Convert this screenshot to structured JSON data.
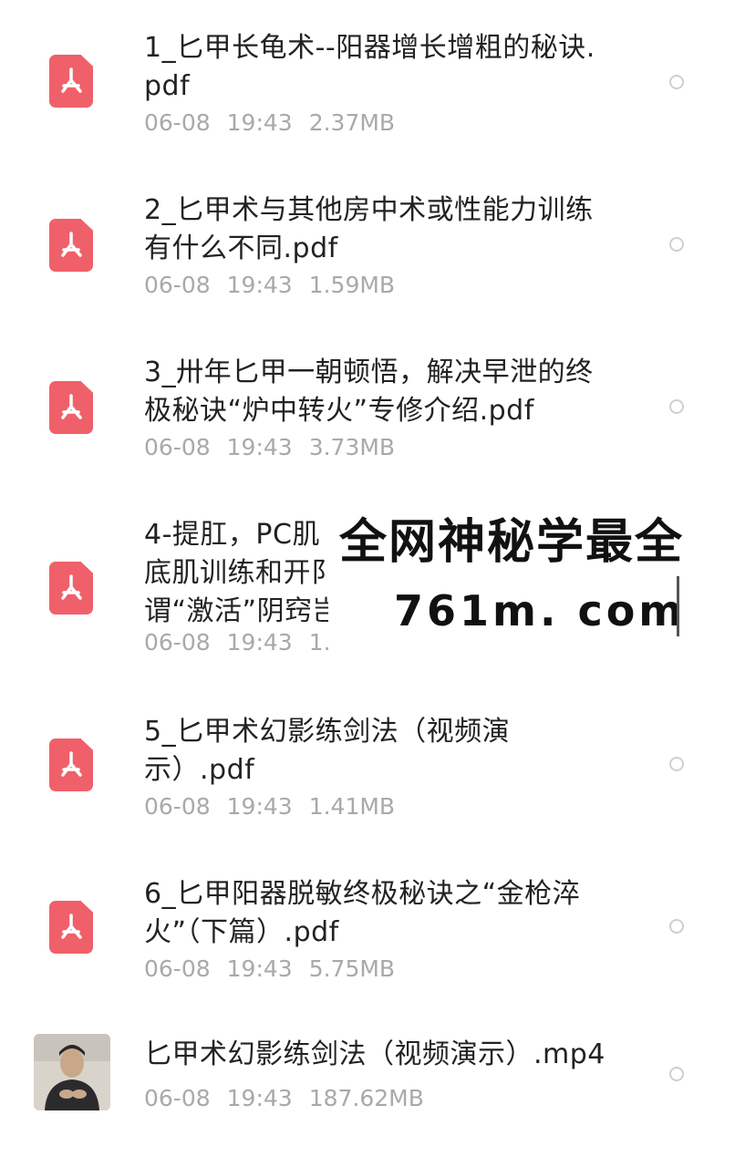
{
  "files": [
    {
      "name": "1_匕甲长龟术--阳器增长增粗的秘诀.pdf",
      "date": "06-08",
      "time": "19:43",
      "size": "2.37MB",
      "type": "pdf-icon"
    },
    {
      "name": "2_匕甲术与其他房中术或性能力训练有什么不同.pdf",
      "date": "06-08",
      "time": "19:43",
      "size": "1.59MB",
      "type": "pdf-icon"
    },
    {
      "name": "3_卅年匕甲一朝顿悟，解决早泄的终极秘诀“炉中转火”专修介绍.pdf",
      "date": "06-08",
      "time": "19:43",
      "size": "3.73MB",
      "type": "pdf-icon"
    },
    {
      "name": "4-提肛，PC肌底肌训练和开阝谓“激活”阴窍岂",
      "date": "06-08",
      "time": "19:43",
      "size": "1.",
      "type": "pdf-icon"
    },
    {
      "name": "5_匕甲术幻影练剑法（视频演示）.pdf",
      "date": "06-08",
      "time": "19:43",
      "size": "1.41MB",
      "type": "pdf-icon"
    },
    {
      "name": "6_匕甲阳器脱敏终极秘诀之“金枪淬火”（下篇）.pdf",
      "date": "06-08",
      "time": "19:43",
      "size": "5.75MB",
      "type": "pdf-icon"
    },
    {
      "name": "匕甲术幻影练剑法（视频演示）.mp4",
      "date": "06-08",
      "time": "19:43",
      "size": "187.62MB",
      "type": "video-thumbnail"
    }
  ],
  "watermark": {
    "line1": "全网神秘学最全",
    "line2": "761m. com"
  },
  "colors": {
    "pdf_icon": "#f0606a",
    "meta_text": "#a9a9a9",
    "name_text": "#222222"
  }
}
